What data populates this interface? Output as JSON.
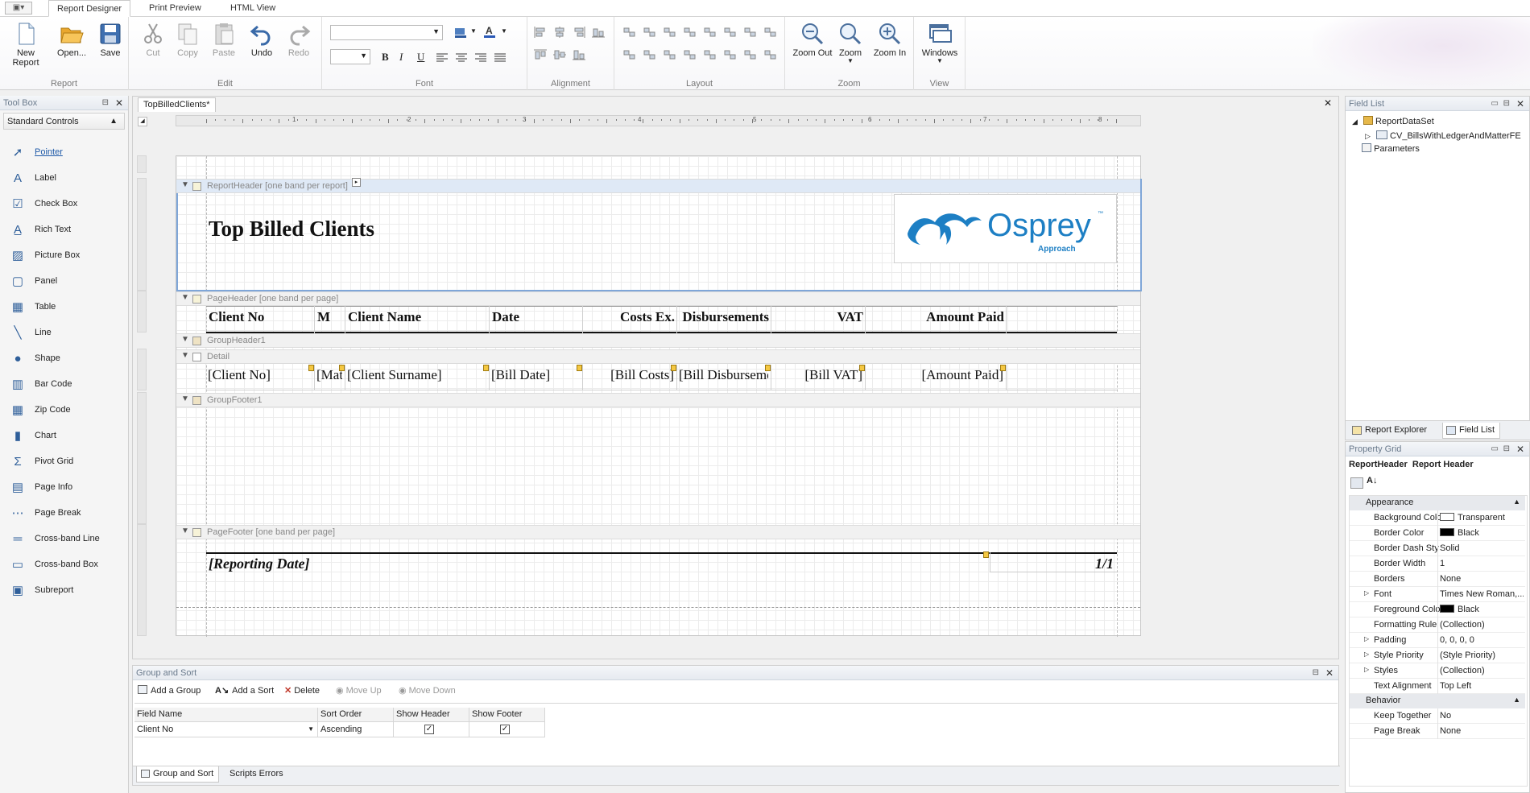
{
  "ribbon": {
    "app_menu": "▣▾",
    "tabs": [
      "Report Designer",
      "Print Preview",
      "HTML View"
    ],
    "groups": {
      "report": "Report",
      "edit": "Edit",
      "font": "Font",
      "alignment": "Alignment",
      "layout": "Layout",
      "zoom": "Zoom",
      "view": "View"
    },
    "buttons": {
      "new_report": "New Report",
      "open": "Open...",
      "save": "Save",
      "cut": "Cut",
      "copy": "Copy",
      "paste": "Paste",
      "undo": "Undo",
      "redo": "Redo",
      "zoom_out": "Zoom Out",
      "zoom": "Zoom",
      "zoom_in": "Zoom In",
      "windows": "Windows"
    },
    "font_name": "",
    "font_size": "",
    "font_buttons": {
      "bold": "B",
      "italic": "I",
      "underline": "U"
    }
  },
  "toolbox": {
    "title": "Tool Box",
    "category": "Standard Controls",
    "items": [
      "Pointer",
      "Label",
      "Check Box",
      "Rich Text",
      "Picture Box",
      "Panel",
      "Table",
      "Line",
      "Shape",
      "Bar Code",
      "Zip Code",
      "Chart",
      "Pivot Grid",
      "Page Info",
      "Page Break",
      "Cross-band Line",
      "Cross-band Box",
      "Subreport"
    ]
  },
  "document": {
    "tab_title": "TopBilledClients*",
    "ruler_numbers": [
      "1",
      "2",
      "3",
      "4",
      "5",
      "6",
      "7",
      "8"
    ],
    "bands": {
      "report_header": "ReportHeader [one band per report]",
      "page_header": "PageHeader [one band per page]",
      "group_header": "GroupHeader1",
      "detail": "Detail",
      "group_footer": "GroupFooter1",
      "page_footer": "PageFooter [one band per page]"
    },
    "report_title": "Top Billed Clients",
    "logo": {
      "name": "Osprey",
      "tagline": "Approach",
      "tm": "™",
      "color": "#1d7fc4"
    },
    "columns": [
      "Client No",
      "M",
      "Client Name",
      "Date",
      "Costs Ex.",
      "Disbursements",
      "VAT",
      "Amount Paid"
    ],
    "detail_fields": [
      "[Client No]",
      "[Mat",
      "[Client Surname]",
      "[Bill Date]",
      "[Bill Costs]",
      "[Bill Disburseme",
      "[Bill VAT]",
      "[Amount Paid]"
    ],
    "footer_left": "[Reporting Date]",
    "footer_right": "1/1"
  },
  "field_list": {
    "title": "Field List",
    "items": [
      "ReportDataSet",
      "CV_BillsWithLedgerAndMatterFE",
      "Parameters"
    ],
    "tabs": [
      "Report Explorer",
      "Field List"
    ]
  },
  "property_grid": {
    "title": "Property Grid",
    "object_name": "ReportHeader",
    "object_type": "Report Header",
    "categories": [
      "Appearance",
      "Behavior"
    ],
    "appearance": [
      {
        "name": "Background Colo",
        "value": "Transparent"
      },
      {
        "name": "Border Color",
        "value": "Black"
      },
      {
        "name": "Border Dash Sty",
        "value": "Solid"
      },
      {
        "name": "Border Width",
        "value": "1"
      },
      {
        "name": "Borders",
        "value": "None"
      },
      {
        "name": "Font",
        "value": "Times New Roman,..."
      },
      {
        "name": "Foreground Colo",
        "value": "Black"
      },
      {
        "name": "Formatting Rule",
        "value": "(Collection)"
      },
      {
        "name": "Padding",
        "value": "0, 0, 0, 0"
      },
      {
        "name": "Style Priority",
        "value": "(Style Priority)"
      },
      {
        "name": "Styles",
        "value": "(Collection)"
      },
      {
        "name": "Text Alignment",
        "value": "Top Left"
      }
    ],
    "behavior": [
      {
        "name": "Keep Together",
        "value": "No"
      },
      {
        "name": "Page Break",
        "value": "None"
      }
    ]
  },
  "group_sort": {
    "title": "Group and Sort",
    "toolbar": {
      "add_group": "Add a Group",
      "add_sort": "Add a Sort",
      "delete": "Delete",
      "move_up": "Move Up",
      "move_down": "Move Down"
    },
    "columns": [
      "Field Name",
      "Sort Order",
      "Show Header",
      "Show Footer"
    ],
    "row": {
      "field": "Client No",
      "order": "Ascending",
      "show_header": true,
      "show_footer": true
    },
    "tabs": [
      "Group and Sort",
      "Scripts Errors"
    ]
  }
}
